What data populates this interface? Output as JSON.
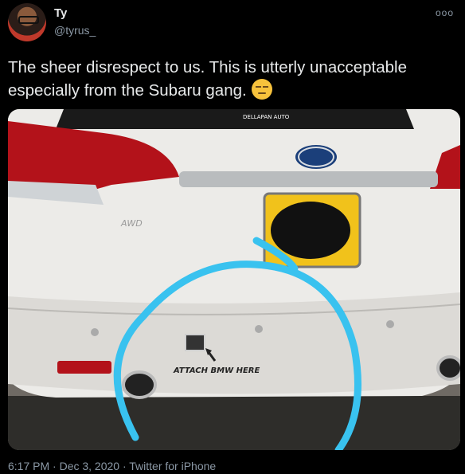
{
  "tweet": {
    "author_name": "Ty",
    "author_handle": "@tyrus_",
    "text": "The sheer disrespect to us. This is utterly unacceptable especially from the Subaru gang.",
    "emoji_icon": "unamused-face-icon",
    "timestamp": "6:17 PM · Dec 3, 2020 · Twitter for iPhone",
    "more_icon": "more-options-icon"
  },
  "photo": {
    "annotation_text": "ATTACH BMW HERE",
    "badge_text": "AWD",
    "dealer_text": "DELLAPAN AUTO"
  }
}
